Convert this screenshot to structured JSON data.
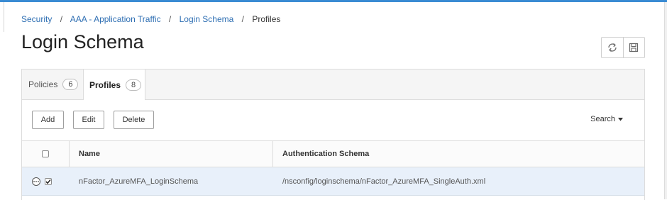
{
  "breadcrumb": {
    "items": [
      "Security",
      "AAA - Application Traffic",
      "Login Schema"
    ],
    "current": "Profiles",
    "separator": "/"
  },
  "page_title": "Login Schema",
  "header_actions": {
    "icons": [
      "refresh-icon",
      "save-icon"
    ]
  },
  "tabs": [
    {
      "label": "Policies",
      "count": "6",
      "active": false
    },
    {
      "label": "Profiles",
      "count": "8",
      "active": true
    }
  ],
  "toolbar": {
    "add_label": "Add",
    "edit_label": "Edit",
    "delete_label": "Delete",
    "search_label": "Search"
  },
  "table": {
    "columns": [
      "Name",
      "Authentication Schema"
    ],
    "rows": [
      {
        "name": "nFactor_AzureMFA_LoginSchema",
        "auth_schema": "/nsconfig/loginschema/nFactor_AzureMFA_SingleAuth.xml",
        "checked": true
      }
    ]
  },
  "colors": {
    "accent": "#3a8bd3",
    "link": "#2f6fb3",
    "selected_row": "#e8f0fa"
  }
}
